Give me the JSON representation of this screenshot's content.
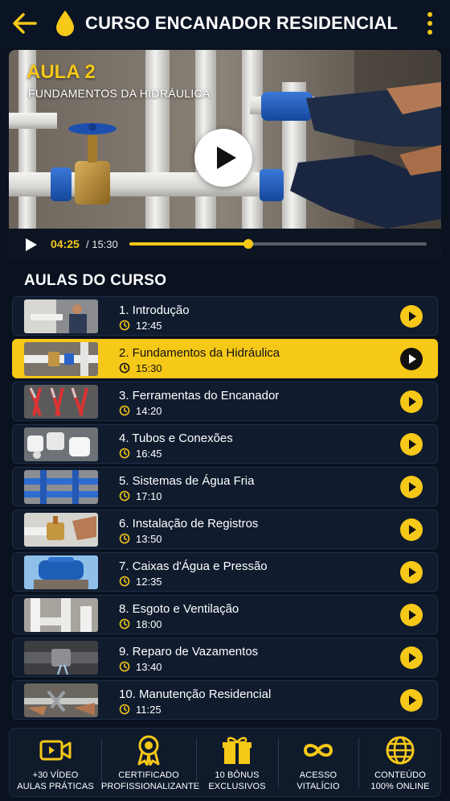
{
  "header": {
    "title": "CURSO ENCANADOR RESIDENCIAL"
  },
  "player": {
    "lesson_number": "AULA 2",
    "lesson_title": "FUNDAMENTOS DA HIDRÁULICA",
    "current_time": "04:25",
    "total_time": "/ 15:30",
    "progress_fraction": 0.4
  },
  "section_title": "AULAS DO CURSO",
  "lessons": [
    {
      "title": "1. Introdução",
      "duration": "12:45"
    },
    {
      "title": "2. Fundamentos da Hidráulica",
      "duration": "15:30",
      "active": true
    },
    {
      "title": "3. Ferramentas do Encanador",
      "duration": "14:20"
    },
    {
      "title": "4. Tubos e Conexões",
      "duration": "16:45"
    },
    {
      "title": "5. Sistemas de Água Fria",
      "duration": "17:10"
    },
    {
      "title": "6. Instalação de Registros",
      "duration": "13:50"
    },
    {
      "title": "7. Caixas d'Água e Pressão",
      "duration": "12:35"
    },
    {
      "title": "8. Esgoto e Ventilação",
      "duration": "18:00"
    },
    {
      "title": "9. Reparo de Vazamentos",
      "duration": "13:40"
    },
    {
      "title": "10. Manutenção Residencial",
      "duration": "11:25"
    }
  ],
  "features": [
    {
      "line1": "+30 VÍDEO",
      "line2": "AULAS PRÁTICAS",
      "icon": "video-camera-icon"
    },
    {
      "line1": "CERTIFICADO",
      "line2": "PROFISSIONALIZANTE",
      "icon": "certificate-icon"
    },
    {
      "line1": "10 BÔNUS",
      "line2": "EXCLUSIVOS",
      "icon": "gift-icon"
    },
    {
      "line1": "ACESSO",
      "line2": "VITALÍCIO",
      "icon": "infinity-icon"
    },
    {
      "line1": "CONTEÚDO",
      "line2": "100% ONLINE",
      "icon": "globe-icon"
    }
  ],
  "colors": {
    "accent": "#f6c818",
    "background": "#0a1220",
    "card": "#101b2e"
  }
}
